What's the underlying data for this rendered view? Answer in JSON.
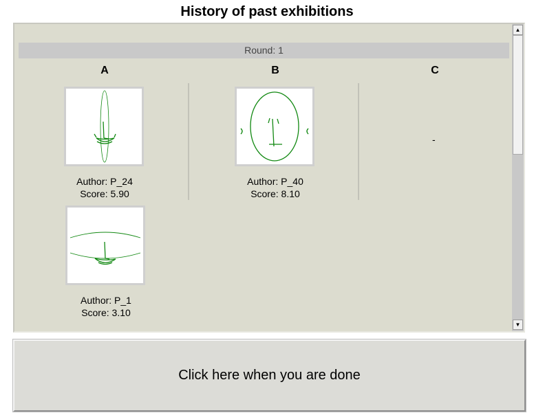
{
  "title": "History of past exhibitions",
  "round_label": "Round: 1",
  "columns": [
    "A",
    "B",
    "C"
  ],
  "entries": [
    {
      "author": "Author: P_24",
      "score": "Score: 5.90",
      "drawing": "face-a-icon"
    },
    {
      "author": "Author: P_40",
      "score": "Score: 8.10",
      "drawing": "face-b-icon"
    },
    {
      "author": "Author: P_1",
      "score": "Score: 3.10",
      "drawing": "face-c-icon"
    }
  ],
  "empty_column_text": "-",
  "done_button": "Click here when you are done",
  "colors": {
    "panel_bg": "#dcdccf",
    "drawing_stroke": "#118811",
    "button_bg": "#dcdcd7"
  }
}
